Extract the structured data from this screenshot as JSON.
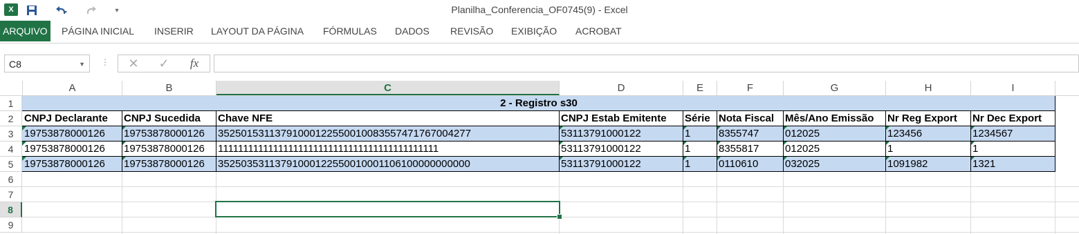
{
  "window": {
    "title": "Planilha_Conferencia_OF0745(9) - Excel",
    "app_icon": "excel-icon"
  },
  "qat": {
    "save": "save-icon",
    "undo": "undo-icon",
    "redo": "redo-icon",
    "customize": "customize-icon"
  },
  "ribbon": {
    "tabs": [
      "ARQUIVO",
      "PÁGINA INICIAL",
      "INSERIR",
      "LAYOUT DA PÁGINA",
      "FÓRMULAS",
      "DADOS",
      "REVISÃO",
      "EXIBIÇÃO",
      "ACROBAT"
    ],
    "active_tab": "ARQUIVO"
  },
  "formula_bar": {
    "name_box": "C8",
    "cancel_glyph": "✕",
    "enter_glyph": "✓",
    "fx_glyph": "fx",
    "formula": ""
  },
  "sheet": {
    "columns": [
      "A",
      "B",
      "C",
      "D",
      "E",
      "F",
      "G",
      "H",
      "I"
    ],
    "selected_column": "C",
    "rows": [
      "1",
      "2",
      "3",
      "4",
      "5",
      "6",
      "7",
      "8",
      "9"
    ],
    "selected_row": "8",
    "title": "2 - Registro s30",
    "headers": [
      "CNPJ Declarante",
      "CNPJ Sucedida",
      "Chave NFE",
      "CNPJ Estab Emitente",
      "Série",
      "Nota Fiscal",
      "Mês/Ano Emissão",
      "Nr Reg Export",
      "Nr Dec Export"
    ],
    "data": [
      [
        "19753878000126",
        "19753878000126",
        "35250153113791000122550010083557471767004277",
        "53113791000122",
        "1",
        "8355747",
        "012025",
        "123456",
        "1234567"
      ],
      [
        "19753878000126",
        "19753878000126",
        "11111111111111111111111111111111111111111111",
        "53113791000122",
        "1",
        "8355817",
        "012025",
        "1",
        "1"
      ],
      [
        "19753878000126",
        "19753878000126",
        "35250353113791000122550010001106100000000000",
        "53113791000122",
        "1",
        "0110610",
        "032025",
        "1091982",
        "1321"
      ]
    ],
    "highlight_color": "#c5d9f1",
    "accent_color": "#217346"
  }
}
